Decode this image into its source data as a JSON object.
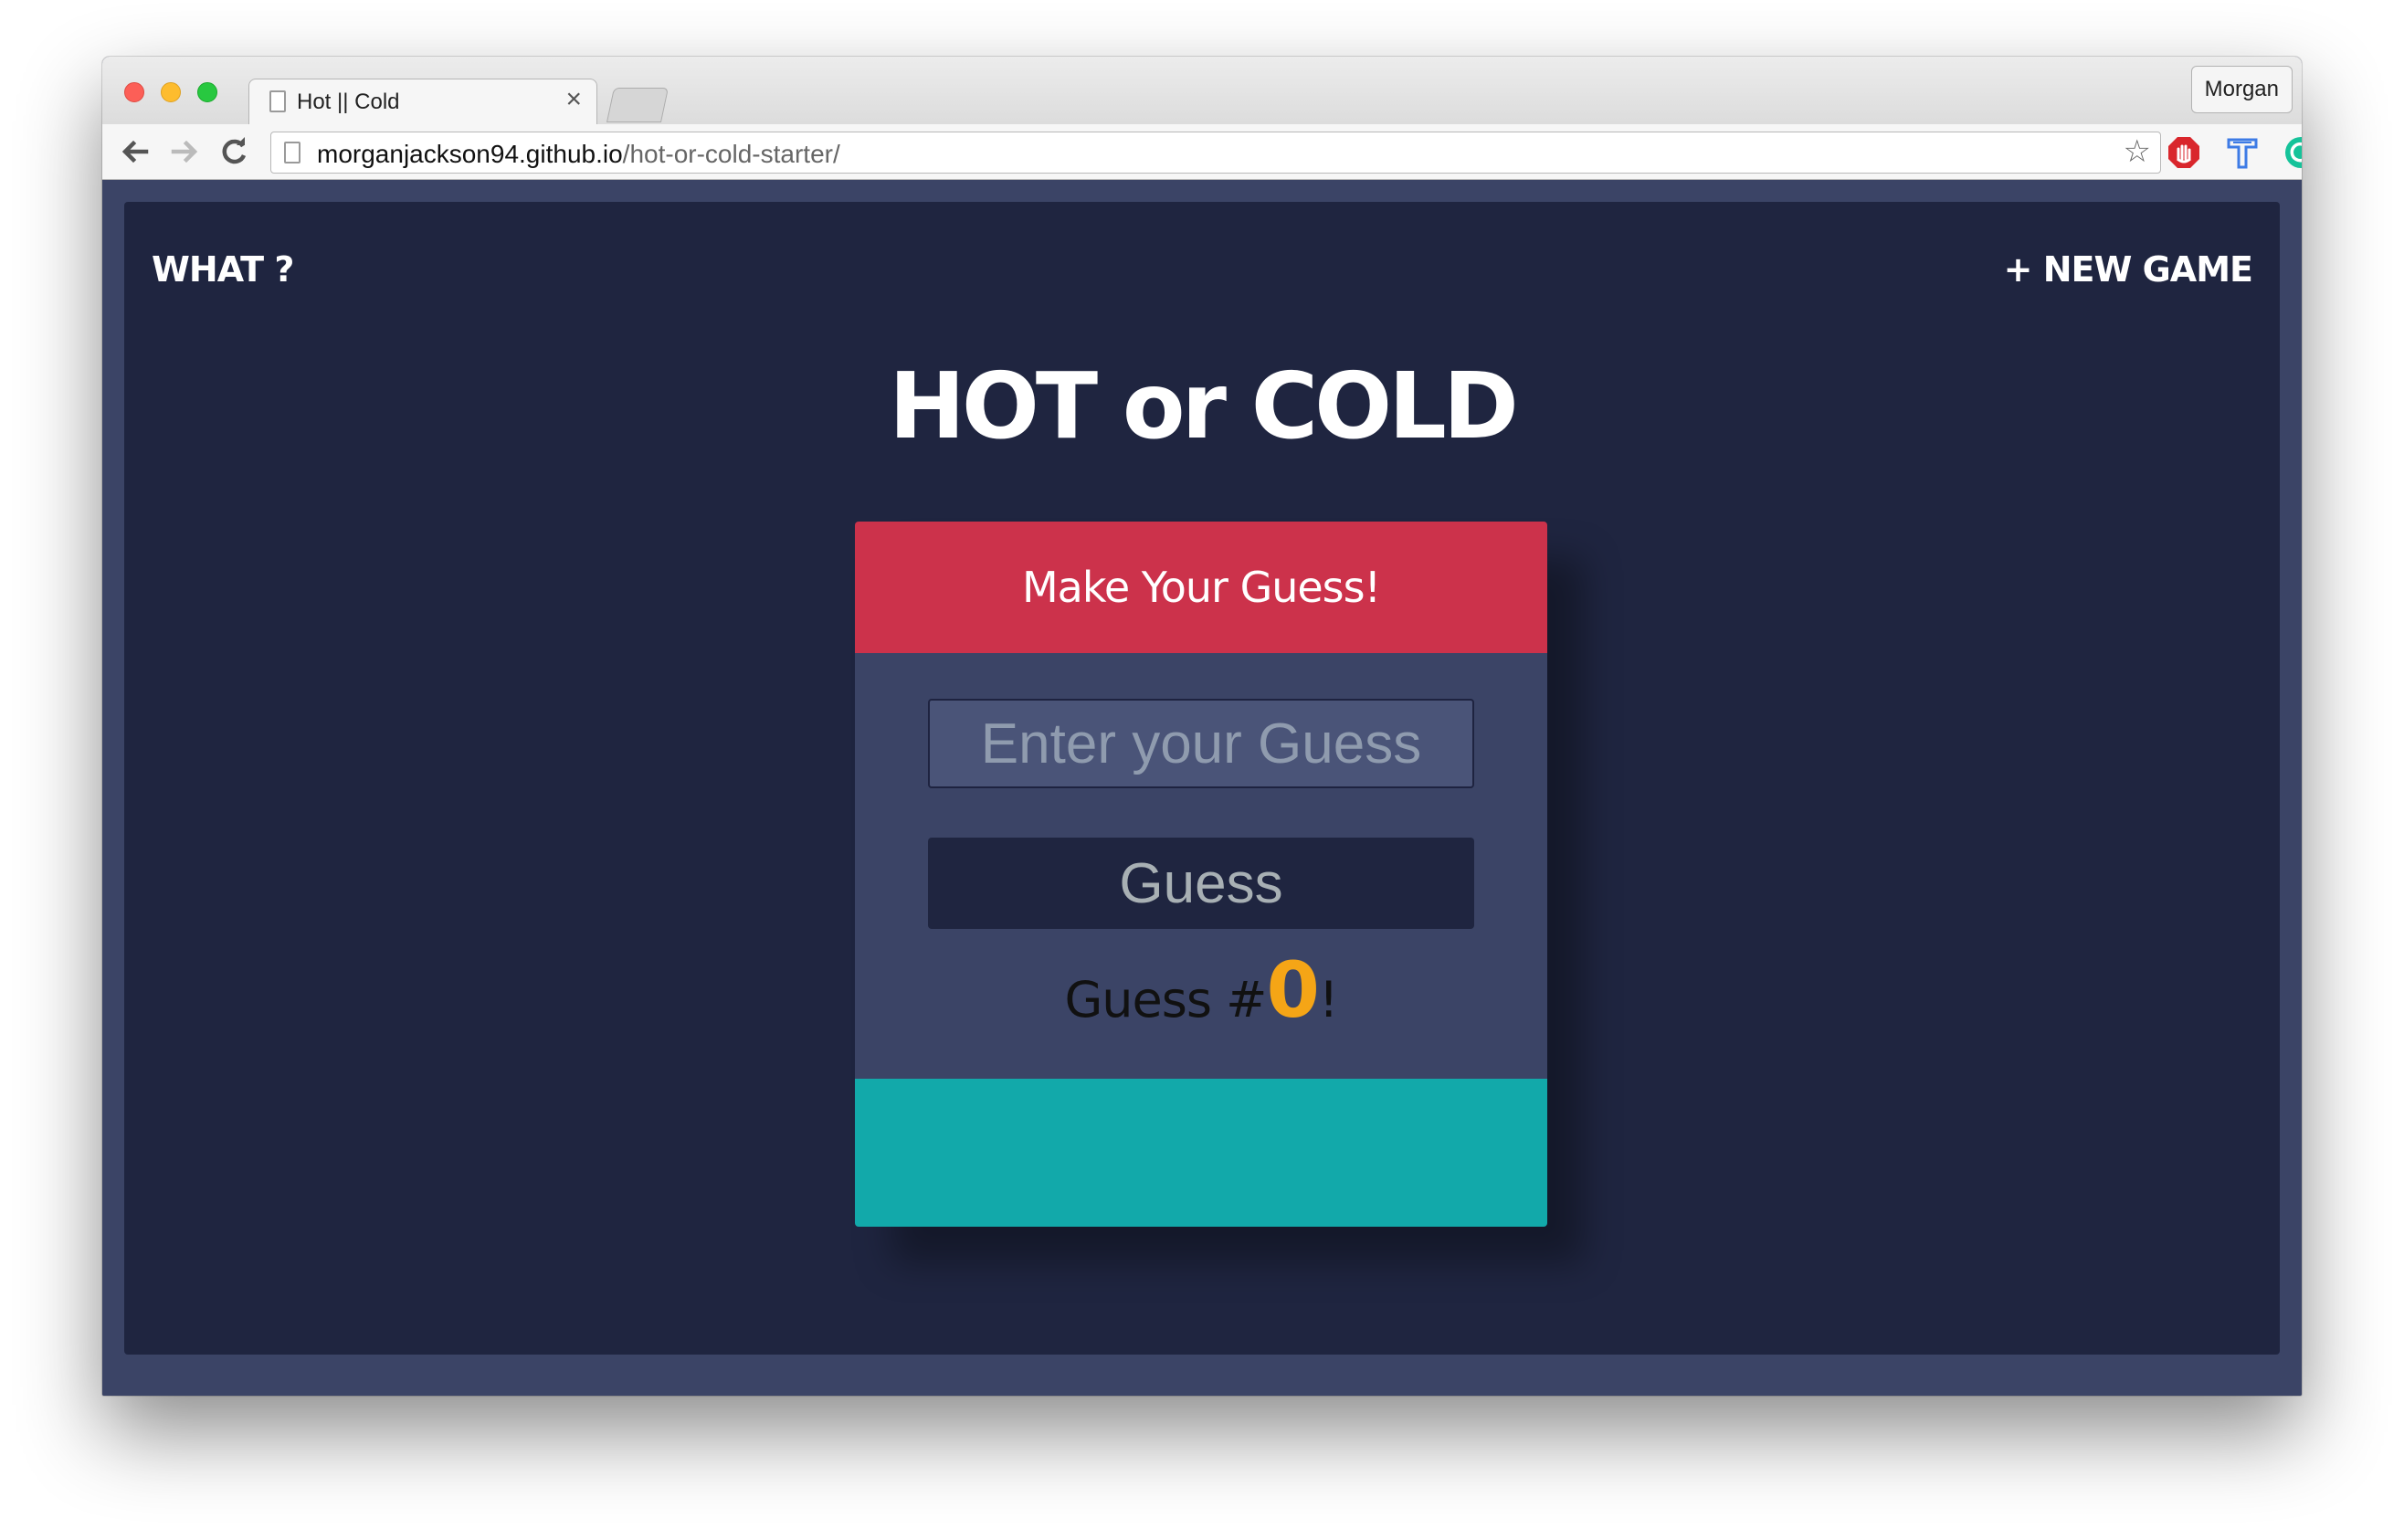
{
  "browser": {
    "tab_title": "Hot || Cold",
    "tab_close": "×",
    "profile_name": "Morgan",
    "url_host": "morganjackson94.github.io",
    "url_path": "/hot-or-cold-starter/",
    "star": "☆",
    "icons": [
      "back-arrow-icon",
      "forward-arrow-icon",
      "reload-icon",
      "bookmark-star-icon",
      "adblock-icon",
      "extension-t-icon",
      "grammarly-icon",
      "menu-icon"
    ]
  },
  "nav": {
    "what": "WHAT ?",
    "new_game": "+ NEW GAME"
  },
  "title": "HOT or COLD",
  "card": {
    "header": "Make Your Guess!",
    "input_placeholder": "Enter your Guess",
    "input_value": "",
    "button_label": "Guess",
    "counter_prefix": "Guess #",
    "counter_value": "0",
    "counter_suffix": "!"
  },
  "colors": {
    "page_bg": "#1f2540",
    "frame_bg": "#3b4466",
    "header_red": "#cc324b",
    "footer_teal": "#12a9aa",
    "count_orange": "#f5a516"
  }
}
